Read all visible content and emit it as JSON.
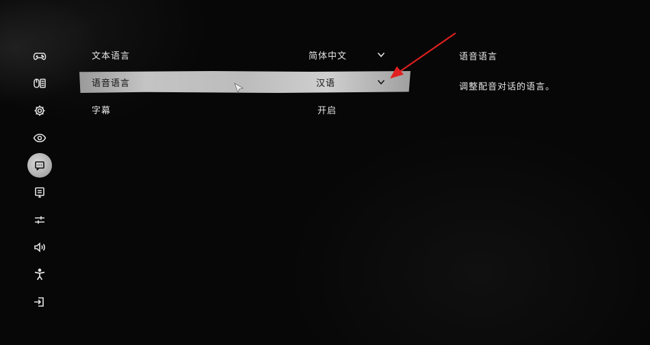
{
  "sidebar": {
    "items": [
      {
        "name": "controller-icon",
        "active": false
      },
      {
        "name": "keyboard-mouse-icon",
        "active": false
      },
      {
        "name": "gear-icon",
        "active": false
      },
      {
        "name": "eye-icon",
        "active": false
      },
      {
        "name": "language-icon",
        "active": true
      },
      {
        "name": "display-icon",
        "active": false
      },
      {
        "name": "sliders-icon",
        "active": false
      },
      {
        "name": "speaker-icon",
        "active": false
      },
      {
        "name": "accessibility-icon",
        "active": false
      },
      {
        "name": "exit-icon",
        "active": false
      }
    ]
  },
  "settings": {
    "rows": [
      {
        "label": "文本语言",
        "value": "简体中文",
        "has_dropdown": true,
        "selected": false
      },
      {
        "label": "语音语言",
        "value": "汉语",
        "has_dropdown": true,
        "selected": true
      },
      {
        "label": "字幕",
        "value": "开启",
        "has_dropdown": false,
        "selected": false
      }
    ]
  },
  "description": {
    "title": "语音语言",
    "body": "调整配音对话的语言。"
  },
  "colors": {
    "background": "#070707",
    "text": "#e6e6e6",
    "selected_text": "#111111",
    "annotation_arrow": "#e02020"
  }
}
